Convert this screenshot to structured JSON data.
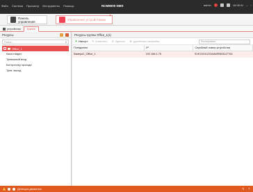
{
  "titlebar": {
    "menu": [
      "Файл",
      "Система",
      "Просмотр",
      "Инструменты",
      "Помощь"
    ],
    "app_title_main": "NCM",
    "app_title_accent": "",
    "app_title_rest": "8000 NMS",
    "user": "admin",
    "time": "16:08:31"
  },
  "tabs": {
    "control_panel": "Панель управления",
    "device_management": "Управление устройствами"
  },
  "subtabs": {
    "devices": "устройства",
    "group": "Группа"
  },
  "left_panel": {
    "title": "Ресурсы",
    "search_placeholder": "Поиск...",
    "root_node": "Office_1",
    "children": [
      "Канал видео",
      "Тревожный вход",
      "Контроллер прохода",
      "Трев. выход"
    ]
  },
  "right_panel": {
    "title": "Ресурсы группы Office_1(1)",
    "toolbar": {
      "import": "Импорт",
      "edit": "Изменить",
      "delete": "Удалить",
      "remote_config": "удалённая настройка"
    },
    "filter_placeholder": "Фильтровать",
    "columns": [
      "Псевдоним",
      "IP",
      "Серийный номер устройства"
    ],
    "rows": [
      {
        "alias": "Камера1_Office_1",
        "ip": "192.168.1.75",
        "serial": "SVK20191223AAWR803147764"
      }
    ]
  },
  "statusbar": {
    "text": "Детекция движения"
  },
  "colors": {
    "accent": "#e05a20",
    "selection": "#e85050",
    "titlebar": "#2b2b2b"
  }
}
